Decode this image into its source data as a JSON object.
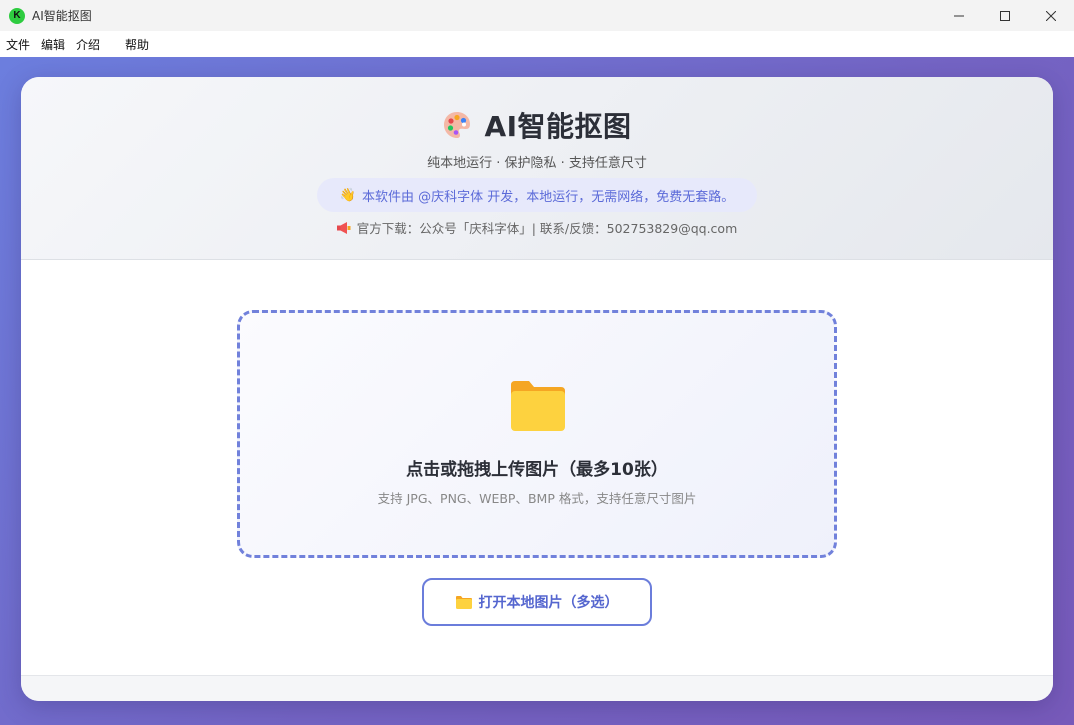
{
  "window": {
    "logo_letter": "K",
    "title": "AI智能抠图"
  },
  "menu": {
    "items": [
      {
        "label": "文件"
      },
      {
        "label": "编辑"
      },
      {
        "label": "介绍"
      },
      {
        "label": "帮助"
      }
    ]
  },
  "header": {
    "icon": "palette-icon",
    "title": "AI智能抠图",
    "subtitle": "纯本地运行 · 保护隐私 · 支持任意尺寸",
    "notice_emoji": "👋",
    "notice": "本软件由 @庆科字体 开发，本地运行，无需网络，免费无套路。",
    "download_icon": "megaphone-icon",
    "download": "官方下载：公众号「庆科字体」| 联系/反馈：502753829@qq.com"
  },
  "upload": {
    "icon": "folder-icon",
    "title": "点击或拖拽上传图片（最多10张）",
    "hint": "支持 JPG、PNG、WEBP、BMP 格式，支持任意尺寸图片",
    "button_label": "打开本地图片（多选）"
  },
  "colors": {
    "accent": "#6b7ddb",
    "gradient_start": "#6c7ede",
    "gradient_end": "#775aba",
    "folder": "#fcd34d"
  }
}
